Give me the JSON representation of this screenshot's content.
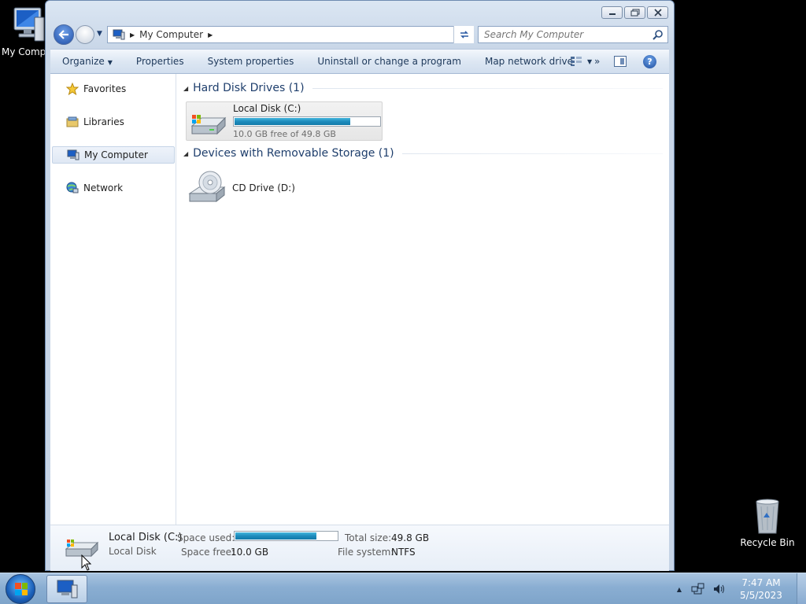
{
  "desktop": {
    "my_computer_label": "My Computer",
    "recycle_bin_label": "Recycle Bin"
  },
  "window": {
    "caption_buttons": [
      "minimize",
      "maximize",
      "close"
    ],
    "address": {
      "crumbs": [
        "My Computer"
      ],
      "icon": "computer-icon"
    },
    "search": {
      "placeholder": "Search My Computer"
    },
    "toolbar": {
      "organize": "Organize",
      "properties": "Properties",
      "system_properties": "System properties",
      "uninstall": "Uninstall or change a program",
      "map_drive": "Map network drive",
      "more": "»"
    },
    "nav": {
      "favorites": "Favorites",
      "libraries": "Libraries",
      "my_computer": "My Computer",
      "network": "Network"
    },
    "groups": {
      "hdd": "Hard Disk Drives (1)",
      "removable": "Devices with Removable Storage (1)"
    },
    "drives": {
      "local": {
        "name": "Local Disk (C:)",
        "free_text": "10.0 GB free of 49.8 GB",
        "used_fraction": 0.8
      },
      "cd": {
        "name": "CD Drive (D:)"
      }
    },
    "details": {
      "name": "Local Disk (C:)",
      "type": "Local Disk",
      "space_used_label": "Space used:",
      "space_free_label": "Space free:",
      "space_free": "10.0 GB",
      "total_size_label": "Total size:",
      "total_size": "49.8 GB",
      "file_system_label": "File system:",
      "file_system": "NTFS"
    }
  },
  "taskbar": {
    "time": "7:47 AM",
    "date": "5/5/2023"
  },
  "colors": {
    "accent_bar": "#1d8bbd",
    "group_header": "#1e3e6c",
    "taskbar": "#8aaed2"
  }
}
